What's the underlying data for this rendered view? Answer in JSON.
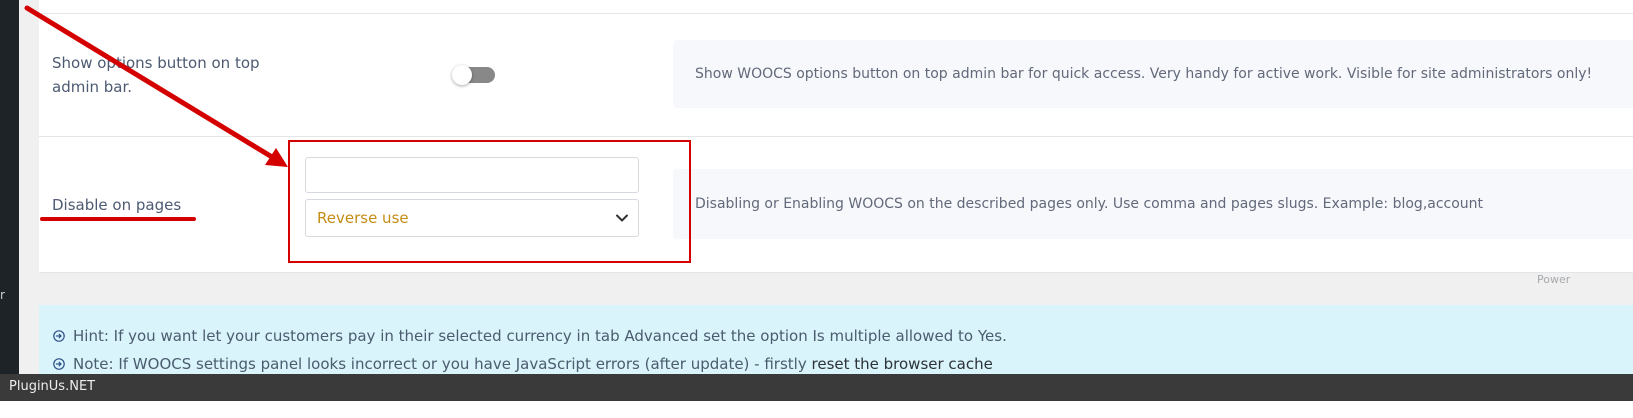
{
  "admin_menu": {
    "fragment_text": "r"
  },
  "settings": {
    "rows": [
      {
        "label": "Show options button on top admin bar.",
        "toggle_on": false,
        "description": "Show WOOCS options button on top admin bar for quick access. Very handy for active work. Visible for site administrators only!"
      },
      {
        "label": "Disable on pages",
        "input_value": "",
        "select_value": "Reverse use",
        "description": "Disabling or Enabling WOOCS on the described pages only. Use comma and pages slugs. Example: blog,account"
      }
    ],
    "powered_fragment": "Power"
  },
  "hints": [
    {
      "icon": "arrow-circle-right-icon",
      "text": "Hint: If you want let your customers pay in their selected currency in tab Advanced set the option Is multiple allowed to Yes."
    },
    {
      "icon": "arrow-circle-right-icon",
      "text": "Note: If WOOCS settings panel looks incorrect or you have JavaScript errors (after update) - firstly ",
      "link": "reset the browser cache"
    }
  ],
  "footer": {
    "brand": "PluginUs.NET"
  },
  "colors": {
    "accent_select": "#c48d13",
    "hint_background": "#d9f4fb",
    "annotation_red": "#d40000"
  }
}
